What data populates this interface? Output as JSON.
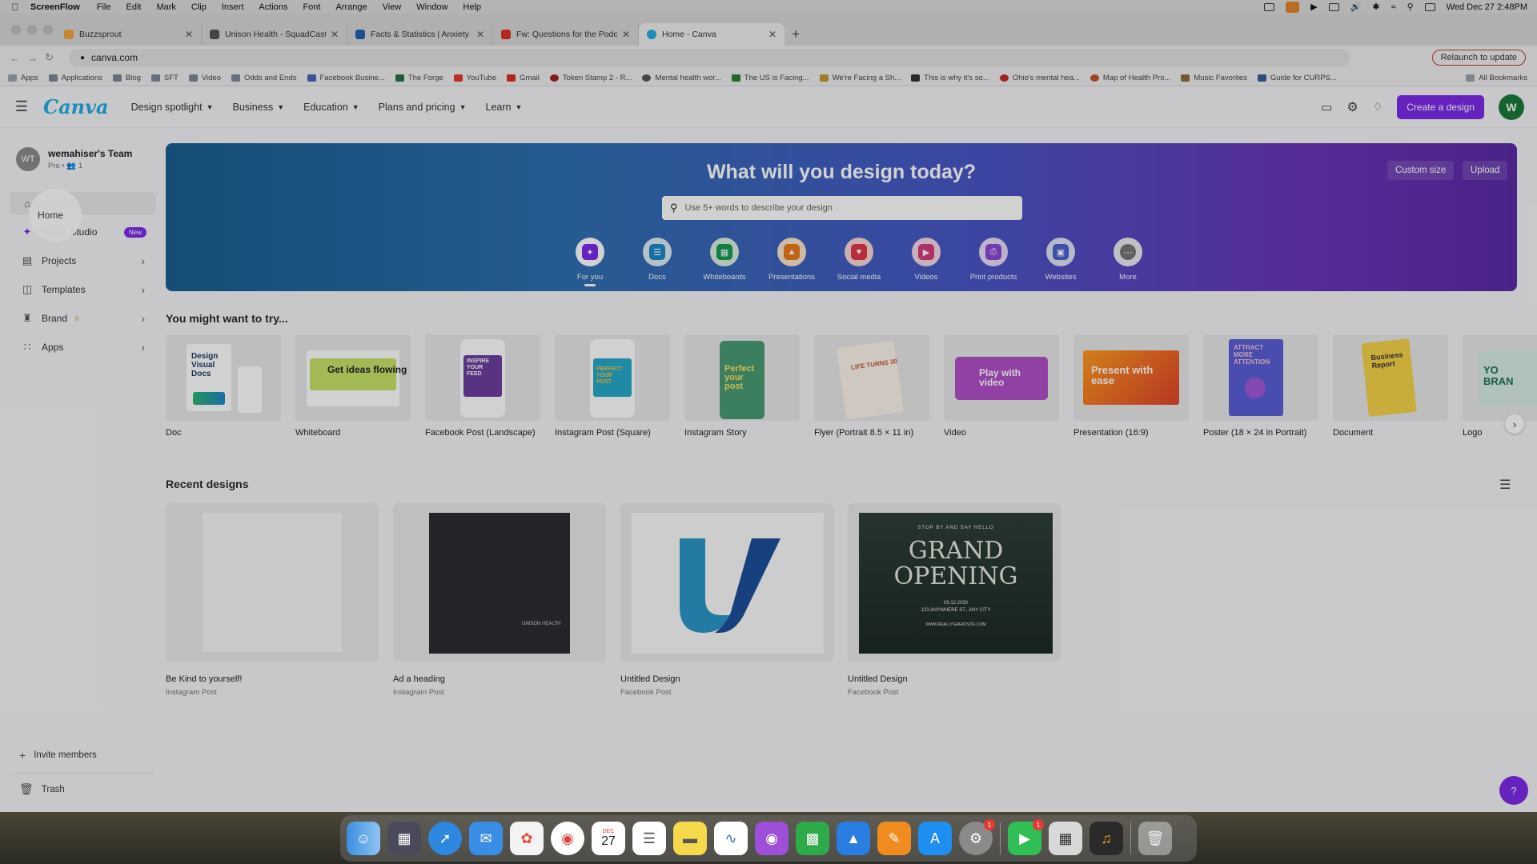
{
  "menubar": {
    "app": "ScreenFlow",
    "items": [
      "File",
      "Edit",
      "Mark",
      "Clip",
      "Insert",
      "Actions",
      "Font",
      "Arrange",
      "View",
      "Window",
      "Help"
    ],
    "clock": "Wed Dec 27  2:48PM"
  },
  "browser": {
    "tabs": [
      {
        "title": "Buzzsprout",
        "color": "#f2a33a"
      },
      {
        "title": "Unison Health - SquadCast",
        "color": "#555555"
      },
      {
        "title": "Facts & Statistics | Anxiety an",
        "color": "#2a5fb0"
      },
      {
        "title": "Fw: Questions for the Podcast",
        "color": "#d93025"
      },
      {
        "title": "Home - Canva",
        "color": "#21aee3"
      }
    ],
    "url": "canva.com",
    "relaunch": "Relaunch to update",
    "bookmarks": [
      "Apps",
      "Applications",
      "Blog",
      "SFT",
      "Video",
      "Odds and Ends",
      "Facebook Busine...",
      "The Forge",
      "YouTube",
      "Gmail",
      "Token Stamp 2 - R...",
      "Mental health wor...",
      "The US is Facing...",
      "We're Facing a Sh...",
      "This is why it's so...",
      "Ohio's mental hea...",
      "Map of Health Pro...",
      "Music Favorites",
      "Guide for CURPS..."
    ],
    "all_bookmarks": "All Bookmarks"
  },
  "canva": {
    "logo": "Canva",
    "nav": [
      "Design spotlight",
      "Business",
      "Education",
      "Plans and pricing",
      "Learn"
    ],
    "create_button": "Create a design",
    "avatar_letter": "W",
    "team": {
      "initials": "WT",
      "name": "wemahiser's Team",
      "sub": "Pro • 👥 1"
    },
    "sidebar": {
      "home": "Home",
      "magic": "Magic Studio",
      "magic_badge": "New",
      "projects": "Projects",
      "templates": "Templates",
      "brand": "Brand",
      "apps": "Apps",
      "invite": "Invite members",
      "trash": "Trash"
    },
    "hero": {
      "title": "What will you design today?",
      "custom_size": "Custom size",
      "upload": "Upload",
      "search_placeholder": "Use 5+ words to describe your design",
      "categories": [
        "For you",
        "Docs",
        "Whiteboards",
        "Presentations",
        "Social media",
        "Videos",
        "Print products",
        "Websites",
        "More"
      ]
    },
    "try_title": "You might want to try...",
    "try_items": [
      "Doc",
      "Whiteboard",
      "Facebook Post (Landscape)",
      "Instagram Post (Square)",
      "Instagram Story",
      "Flyer (Portrait 8.5 × 11 in)",
      "Video",
      "Presentation (16:9)",
      "Poster (18 × 24 in Portrait)",
      "Document",
      "Logo"
    ],
    "thumb_text": {
      "doc": "Design Visual Docs",
      "whiteboard": "Get ideas flowing",
      "fb_post": "INSPIRE YOUR FEED",
      "ig_post": "PERFECT YOUR POST",
      "story": "Perfect your post",
      "flyer": "LIFE TURNS 30",
      "video": "Play with video",
      "presentation": "Present with ease",
      "poster": "ATTRACT MORE ATTENTION",
      "document": "Business Report",
      "logo": "YO BRAN"
    },
    "recent_title": "Recent designs",
    "recent": [
      {
        "title": "Be Kind to yourself!",
        "sub": "Instagram Post"
      },
      {
        "title": "Ad a heading",
        "sub": "Instagram Post"
      },
      {
        "title": "Untitled Design",
        "sub": "Facebook Post"
      },
      {
        "title": "Untitled Design",
        "sub": "Facebook Post"
      }
    ],
    "grand_opening": {
      "line1": "GRAND",
      "line2": "OPENING",
      "top": "STOP BY AND SAY HELLO",
      "date": "09.12.2030",
      "addr": "123 ANYWHERE ST., ANY CITY",
      "site": "WWW.REALLYGREATSITE.COM"
    },
    "ad_logo": "UNISON HEALTH",
    "help": "?"
  },
  "dock": {
    "calendar_day": "27",
    "calendar_month": "DEC",
    "badges": {
      "settings": "1",
      "facetime": "1"
    }
  },
  "colors": {
    "accent": "#7d2ae8",
    "canva_blue": "#21aee3"
  }
}
